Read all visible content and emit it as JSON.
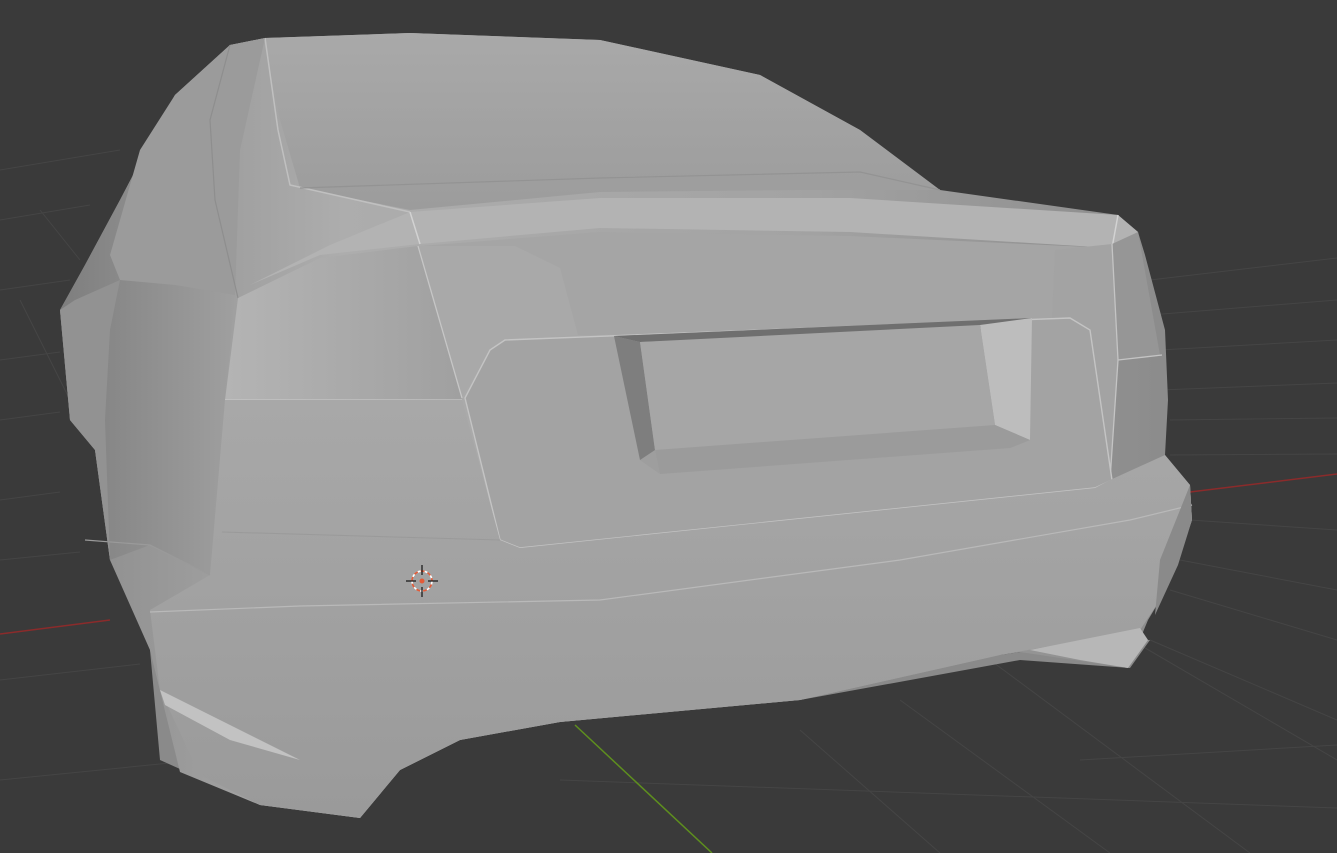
{
  "viewport": {
    "mode": "3D Viewport",
    "shading": "solid",
    "background_color": "#3a3a3a",
    "grid_color": "#454545",
    "x_axis_color": "#8b2b2b",
    "y_axis_color": "#5e8f1e"
  },
  "scene": {
    "object": "car-body-rear-view",
    "model_color": "#a6a6a6",
    "cursor_3d_color": "#e35b38"
  }
}
